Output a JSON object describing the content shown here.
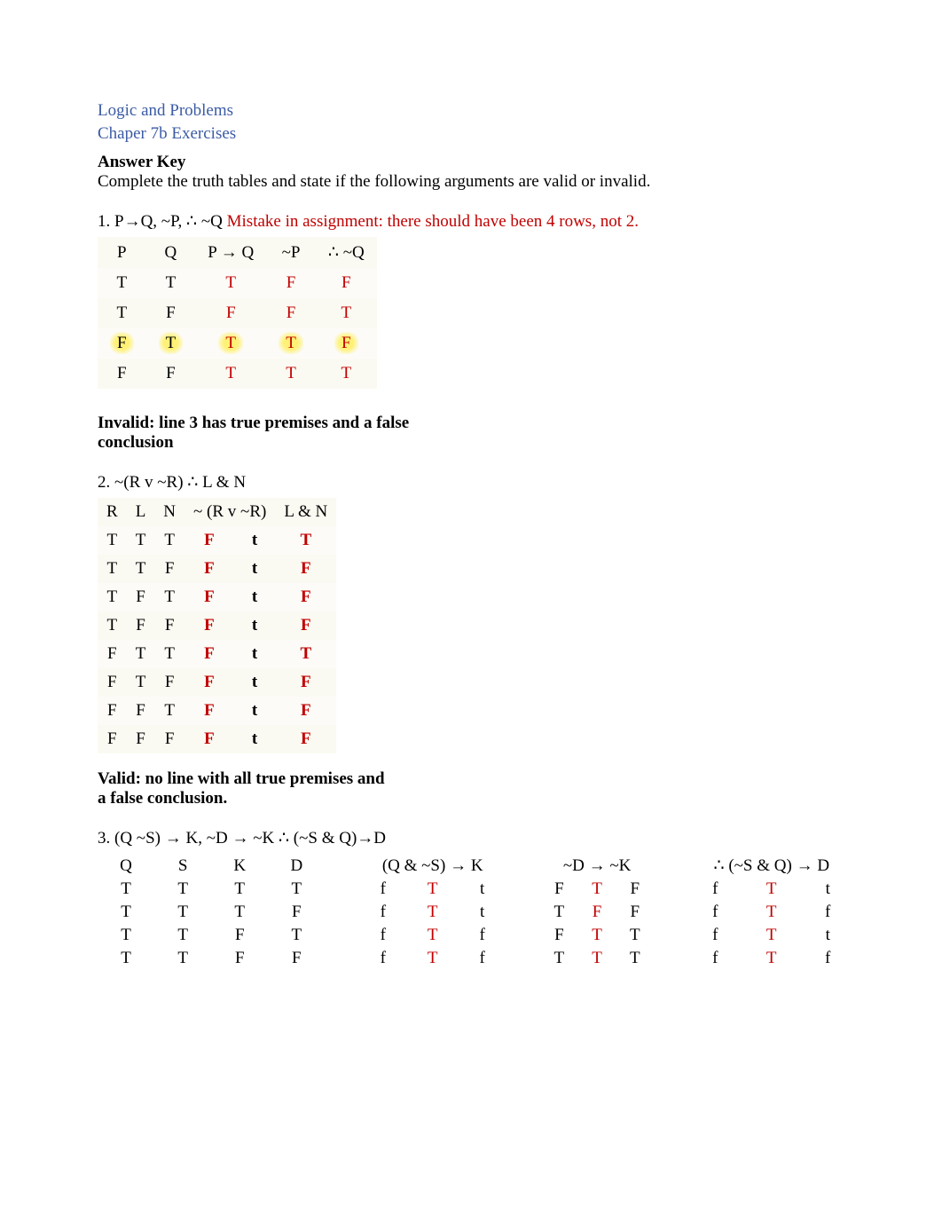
{
  "heading1": "Logic and Problems",
  "heading2": "Chaper 7b Exercises",
  "answer_key": "Answer Key",
  "instructions": "Complete the truth tables and state if the following arguments are valid or invalid.",
  "ex1": {
    "label": "1. P→Q, ~P, ∴ ~Q ",
    "mistake": "Mistake in assignment: there should have been 4 rows, not 2.",
    "headers": [
      "P",
      "Q",
      "P → Q",
      "~P",
      "∴ ~Q"
    ],
    "rows": [
      {
        "cells": [
          "T",
          "T",
          "T",
          "F",
          "F"
        ],
        "hl": false
      },
      {
        "cells": [
          "T",
          "F",
          "F",
          "F",
          "T"
        ],
        "hl": false
      },
      {
        "cells": [
          "F",
          "T",
          "T",
          "T",
          "F"
        ],
        "hl": true
      },
      {
        "cells": [
          "F",
          "F",
          "T",
          "T",
          "T"
        ],
        "hl": false
      }
    ],
    "verdict": "Invalid: line 3 has true premises and a false conclusion"
  },
  "ex2": {
    "label": "2. ~(R v ~R)  ∴ L & N",
    "headers": [
      "R",
      "L",
      "N",
      "~ (R  v ~R)",
      "L  &  N"
    ],
    "rows": [
      [
        "T",
        "T",
        "T",
        "F",
        "t",
        "T"
      ],
      [
        "T",
        "T",
        "F",
        "F",
        "t",
        "F"
      ],
      [
        "T",
        "F",
        "T",
        "F",
        "t",
        "F"
      ],
      [
        "T",
        "F",
        "F",
        "F",
        "t",
        "F"
      ],
      [
        "F",
        "T",
        "T",
        "F",
        "t",
        "T"
      ],
      [
        "F",
        "T",
        "F",
        "F",
        "t",
        "F"
      ],
      [
        "F",
        "F",
        "T",
        "F",
        "t",
        "F"
      ],
      [
        "F",
        "F",
        "F",
        "F",
        "t",
        "F"
      ]
    ],
    "verdict": "Valid: no line with all true premises and a false conclusion."
  },
  "ex3": {
    "label": "3. (Q  ~S) → K, ~D → ~K ∴ (~S & Q)→D",
    "headers": {
      "atoms": [
        "Q",
        "S",
        "K",
        "D"
      ],
      "g1": "(Q & ~S) → K",
      "g2": "~D  →  ~K",
      "g3": "∴ (~S & Q) → D"
    },
    "rows": [
      {
        "atoms": [
          "T",
          "T",
          "T",
          "T"
        ],
        "g1": [
          "f",
          "T",
          "t"
        ],
        "g2": [
          "F",
          "T",
          "F"
        ],
        "g3": [
          "f",
          "T",
          "t"
        ]
      },
      {
        "atoms": [
          "T",
          "T",
          "T",
          "F"
        ],
        "g1": [
          "f",
          "T",
          "t"
        ],
        "g2": [
          "T",
          "F",
          "F"
        ],
        "g3": [
          "f",
          "T",
          "f"
        ]
      },
      {
        "atoms": [
          "T",
          "T",
          "F",
          "T"
        ],
        "g1": [
          "f",
          "T",
          "f"
        ],
        "g2": [
          "F",
          "T",
          "T"
        ],
        "g3": [
          "f",
          "T",
          "t"
        ]
      },
      {
        "atoms": [
          "T",
          "T",
          "F",
          "F"
        ],
        "g1": [
          "f",
          "T",
          "f"
        ],
        "g2": [
          "T",
          "T",
          "T"
        ],
        "g3": [
          "f",
          "T",
          "f"
        ]
      }
    ]
  }
}
